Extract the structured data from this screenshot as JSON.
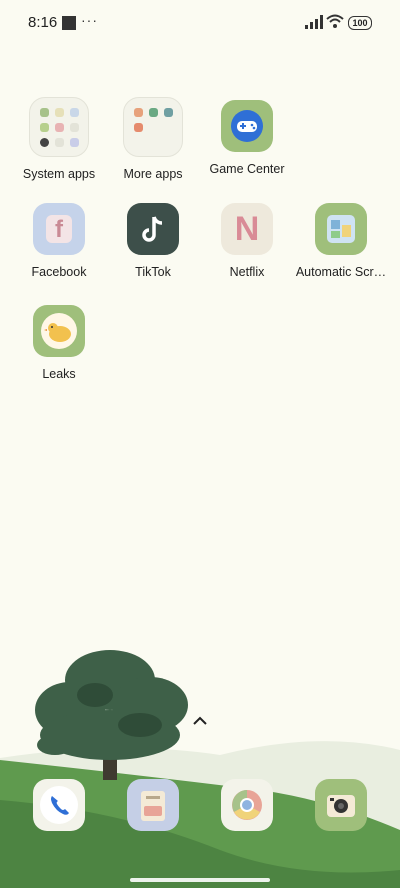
{
  "status": {
    "time": "8:16",
    "notif_dots": "···",
    "battery": "100"
  },
  "apps": {
    "system_apps": "System apps",
    "more_apps": "More apps",
    "game_center": "Game Center",
    "facebook": "Facebook",
    "tiktok": "TikTok",
    "netflix": "Netflix",
    "automatic_screenshot": "Automatic Scr…",
    "leaks": "Leaks"
  },
  "icons": {
    "facebook": "f",
    "netflix": "N"
  },
  "colors": {
    "background": "#fbfbf2",
    "game_center_tile": "#9fbf7b",
    "tiktok_tile": "#3d4f4a",
    "facebook_tile": "#c5d3ea",
    "netflix_tile": "#eee9dc",
    "netflix_letter": "#d98b96",
    "hill": "#5f9a4e"
  }
}
